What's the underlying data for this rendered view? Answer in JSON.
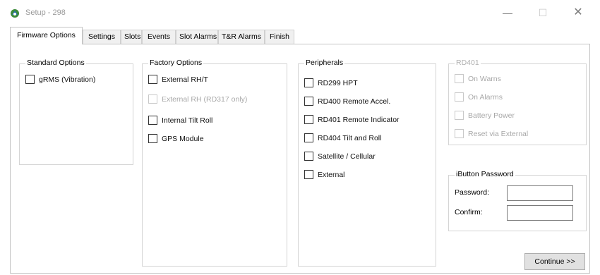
{
  "window": {
    "title": "Setup - 298",
    "minimize_glyph": "—",
    "maximize_glyph": "☐",
    "close_glyph": "✕"
  },
  "tabs": [
    {
      "label": "Firmware Options",
      "active": true
    },
    {
      "label": "Settings"
    },
    {
      "label": "Slots"
    },
    {
      "label": "Events"
    },
    {
      "label": "Slot Alarms"
    },
    {
      "label": "T&R Alarms"
    },
    {
      "label": "Finish"
    }
  ],
  "standard_options": {
    "title": "Standard Options",
    "items": [
      {
        "label": "gRMS (Vibration)",
        "checked": false
      }
    ]
  },
  "factory_options": {
    "title": "Factory Options",
    "items": [
      {
        "label": "External RH/T",
        "checked": false,
        "enabled": true
      },
      {
        "label": "External RH (RD317 only)",
        "checked": false,
        "enabled": false
      },
      {
        "label": "Internal Tilt  Roll",
        "checked": false,
        "enabled": true
      },
      {
        "label": "GPS Module",
        "checked": false,
        "enabled": true
      }
    ]
  },
  "peripherals": {
    "title": "Peripherals",
    "items": [
      {
        "label": "RD299 HPT",
        "checked": false
      },
      {
        "label": "RD400 Remote Accel.",
        "checked": false
      },
      {
        "label": "RD401 Remote Indicator",
        "checked": false
      },
      {
        "label": "RD404 Tilt and Roll",
        "checked": false
      },
      {
        "label": "Satellite / Cellular",
        "checked": false
      },
      {
        "label": "External",
        "checked": false
      }
    ]
  },
  "rd401": {
    "title": "RD401",
    "enabled": false,
    "items": [
      {
        "label": "On Warns",
        "checked": false
      },
      {
        "label": "On Alarms",
        "checked": false
      },
      {
        "label": "Battery Power",
        "checked": false
      },
      {
        "label": "Reset via External",
        "checked": false
      }
    ]
  },
  "ibutton": {
    "title": "iButton Password",
    "password_label": "Password:",
    "password_value": "",
    "confirm_label": "Confirm:",
    "confirm_value": ""
  },
  "continue_label": "Continue >>",
  "colors": {
    "disabled_text": "#a8a8a8",
    "app_icon_green": "#3c8a3a",
    "app_icon_blue": "#2a6fb5"
  }
}
